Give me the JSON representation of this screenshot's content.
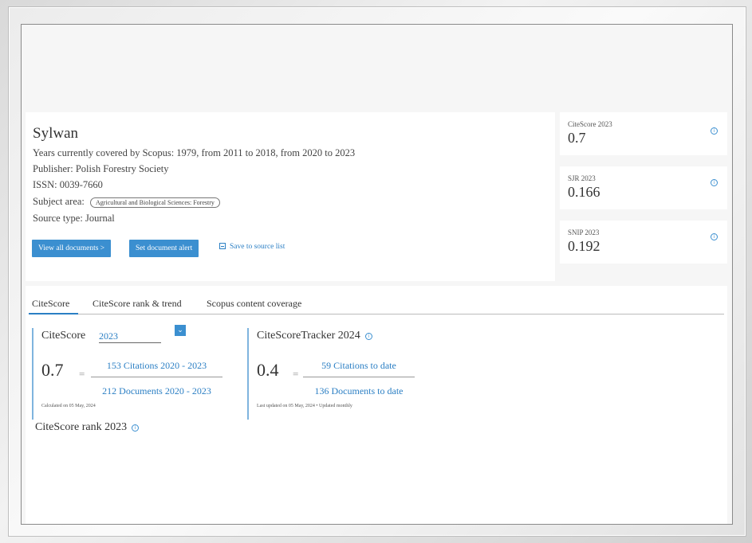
{
  "source": {
    "title": "Sylwan",
    "years_label": "Years currently covered by Scopus:",
    "years_value": "1979, from 2011 to 2018, from 2020 to 2023",
    "publisher_label": "Publisher:",
    "publisher_value": "Polish Forestry Society",
    "issn_label": "ISSN:",
    "issn_value": "0039-7660",
    "subject_label": "Subject area:",
    "subject_value": "Agricultural and Biological Sciences: Forestry",
    "type_label": "Source type:",
    "type_value": "Journal",
    "view_all_label": "View all documents >",
    "alert_label": "Set document alert",
    "save_label": "Save to source list"
  },
  "metrics": [
    {
      "label": "CiteScore 2023",
      "value": "0.7"
    },
    {
      "label": "SJR 2023",
      "value": "0.166"
    },
    {
      "label": "SNIP 2023",
      "value": "0.192"
    }
  ],
  "tabs": [
    "CiteScore",
    "CiteScore rank & trend",
    "Scopus content coverage"
  ],
  "citescore": {
    "title": "CiteScore",
    "year": "2023",
    "value": "0.7",
    "numerator": "153 Citations 2020 - 2023",
    "denominator": "212 Documents 2020 - 2023",
    "note": "Calculated on 05 May, 2024"
  },
  "tracker": {
    "title": "CiteScoreTracker 2024",
    "value": "0.4",
    "numerator": "59 Citations to date",
    "denominator": "136 Documents to date",
    "note": "Last updated on 05 May, 2024 • Updated monthly"
  },
  "rank": {
    "title": "CiteScore rank 2023"
  },
  "symbols": {
    "equals": "=",
    "info": "i",
    "dropdown": "⌄"
  }
}
